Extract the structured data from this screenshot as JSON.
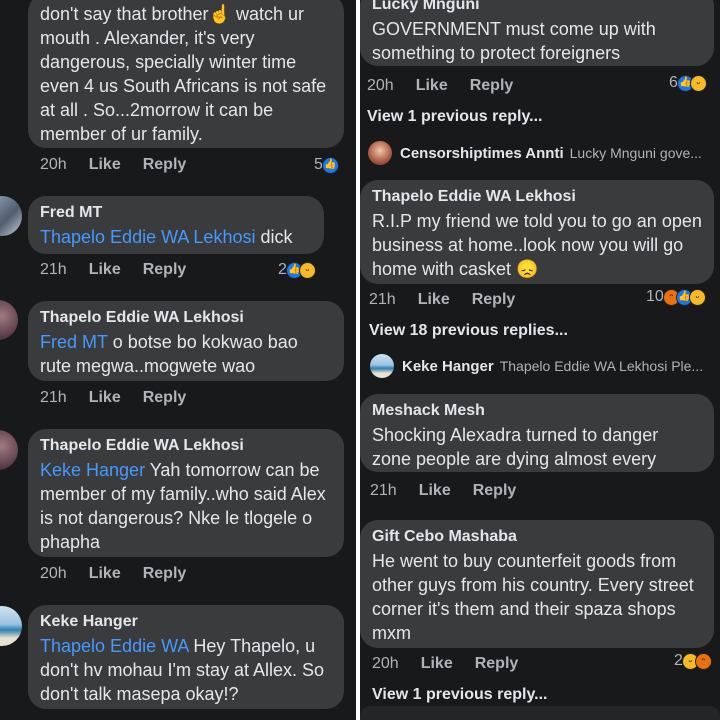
{
  "left": {
    "top_comment": {
      "text": "don't say that brother☝ watch ur mouth . Alexander, it's  very dangerous, specially winter time even 4 us South Africans is not safe at all . So...2morrow it can be member of ur family.",
      "time": "20h",
      "like": "Like",
      "reply": "Reply",
      "reactions": "5"
    },
    "comments": [
      {
        "author": "Fred MT",
        "mention": "Thapelo Eddie WA Lekhosi",
        "text": " dick",
        "time": "21h",
        "like": "Like",
        "reply": "Reply",
        "reactions": "2"
      },
      {
        "author": "Thapelo Eddie WA Lekhosi",
        "mention": "Fred MT",
        "text": " o botse bo kokwao bao rute megwa..mogwete wao",
        "time": "21h",
        "like": "Like",
        "reply": "Reply"
      },
      {
        "author": "Thapelo Eddie WA Lekhosi",
        "mention": "Keke Hanger",
        "text": " Yah tomorrow can be member of my family..who said Alex is not dangerous? Nke le tlogele o phapha",
        "time": "20h",
        "like": "Like",
        "reply": "Reply"
      },
      {
        "author": "Keke Hanger",
        "mention": "Thapelo Eddie WA",
        "text": "  Hey  Thapelo, u don't hv mohau I'm  stay at Allex. So  don't talk masepa  okay!?"
      }
    ]
  },
  "right": {
    "c1": {
      "author": "Lucky Mnguni",
      "text": "GOVERNMENT must come up with something to protect foreigners",
      "time": "20h",
      "like": "Like",
      "reply": "Reply",
      "reactions": "6"
    },
    "view1": "View 1 previous reply...",
    "preview1": {
      "name": "Censorshiptimes Annti",
      "text": "Lucky Mnguni gove..."
    },
    "c2": {
      "author": "Thapelo Eddie WA Lekhosi",
      "text": "R.I.P my friend we told you to go an open business at home..look now you will go home with casket 😞",
      "time": "21h",
      "like": "Like",
      "reply": "Reply",
      "reactions": "10"
    },
    "view2": "View 18 previous replies...",
    "preview2": {
      "name": "Keke Hanger",
      "text": "Thapelo Eddie WA Lekhosi  Ple..."
    },
    "c3": {
      "author": "Meshack Mesh",
      "text": "Shocking Alexadra  turned to danger zone people  are dying almost every",
      "time": "21h",
      "like": "Like",
      "reply": "Reply"
    },
    "c4": {
      "author": "Gift Cebo Mashaba",
      "text": "He went to buy counterfeit goods from other guys from his country. Every street corner it's them and their spaza shops mxm",
      "time": "20h",
      "like": "Like",
      "reply": "Reply",
      "reactions": "2"
    },
    "view3": "View 1 previous reply..."
  },
  "icons": {
    "like": "like-reaction-icon",
    "haha": "haha-reaction-icon",
    "angry": "angry-reaction-icon"
  },
  "colors": {
    "background": "#18191a",
    "bubble": "#3a3b3c",
    "mention": "#4599ff",
    "divider": "#ffffff"
  }
}
